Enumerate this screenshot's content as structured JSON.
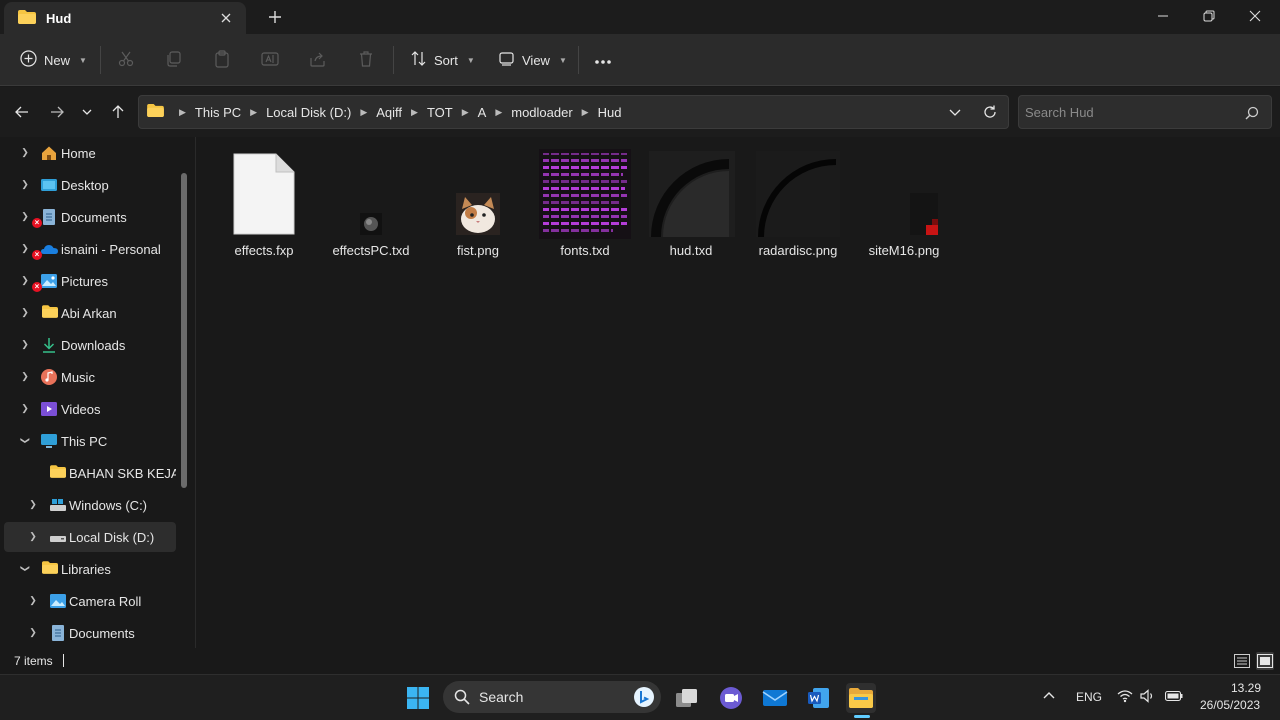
{
  "window": {
    "tab_title": "Hud",
    "new_tab_symbol": "+"
  },
  "toolbar": {
    "new_label": "New",
    "sort_label": "Sort",
    "view_label": "View"
  },
  "address": {
    "breadcrumbs": [
      "This PC",
      "Local Disk (D:)",
      "Aqiff",
      "TOT",
      "A",
      "modloader",
      "Hud"
    ]
  },
  "search": {
    "placeholder": "Search Hud"
  },
  "sidebar": {
    "items": [
      {
        "label": "Home",
        "icon": "home-icon"
      },
      {
        "label": "Desktop",
        "icon": "desktop-icon"
      },
      {
        "label": "Documents",
        "icon": "documents-icon"
      },
      {
        "label": "isnaini - Personal",
        "icon": "onedrive-icon"
      },
      {
        "label": "Pictures",
        "icon": "pictures-icon"
      },
      {
        "label": "Abi Arkan",
        "icon": "folder-icon"
      },
      {
        "label": "Downloads",
        "icon": "downloads-icon"
      },
      {
        "label": "Music",
        "icon": "music-icon"
      },
      {
        "label": "Videos",
        "icon": "videos-icon"
      },
      {
        "label": "This PC",
        "icon": "this-pc-icon"
      },
      {
        "label": "BAHAN SKB KEJAKSAAN",
        "icon": "folder-icon"
      },
      {
        "label": "Windows (C:)",
        "icon": "drive-icon"
      },
      {
        "label": "Local Disk (D:)",
        "icon": "drive-icon"
      },
      {
        "label": "Libraries",
        "icon": "libraries-icon"
      },
      {
        "label": "Camera Roll",
        "icon": "camera-roll-icon"
      },
      {
        "label": "Documents",
        "icon": "documents-icon"
      }
    ]
  },
  "files": [
    {
      "name": "effects.fxp",
      "icon": "generic-file-icon"
    },
    {
      "name": "effectsPC.txd",
      "icon": "effects-thumbnail"
    },
    {
      "name": "fist.png",
      "icon": "cat-image-thumbnail"
    },
    {
      "name": "fonts.txd",
      "icon": "fonts-texture-thumbnail"
    },
    {
      "name": "hud.txd",
      "icon": "hud-texture-thumbnail"
    },
    {
      "name": "radardisc.png",
      "icon": "radar-disc-thumbnail"
    },
    {
      "name": "siteM16.png",
      "icon": "site-m16-thumbnail"
    }
  ],
  "status": {
    "item_count": "7 items"
  },
  "taskbar": {
    "search_label": "Search",
    "language": "ENG",
    "time": "13.29",
    "date": "26/05/2023"
  },
  "colors": {
    "folder": "#f5c542",
    "accent": "#60cdff",
    "error": "#e81123"
  }
}
